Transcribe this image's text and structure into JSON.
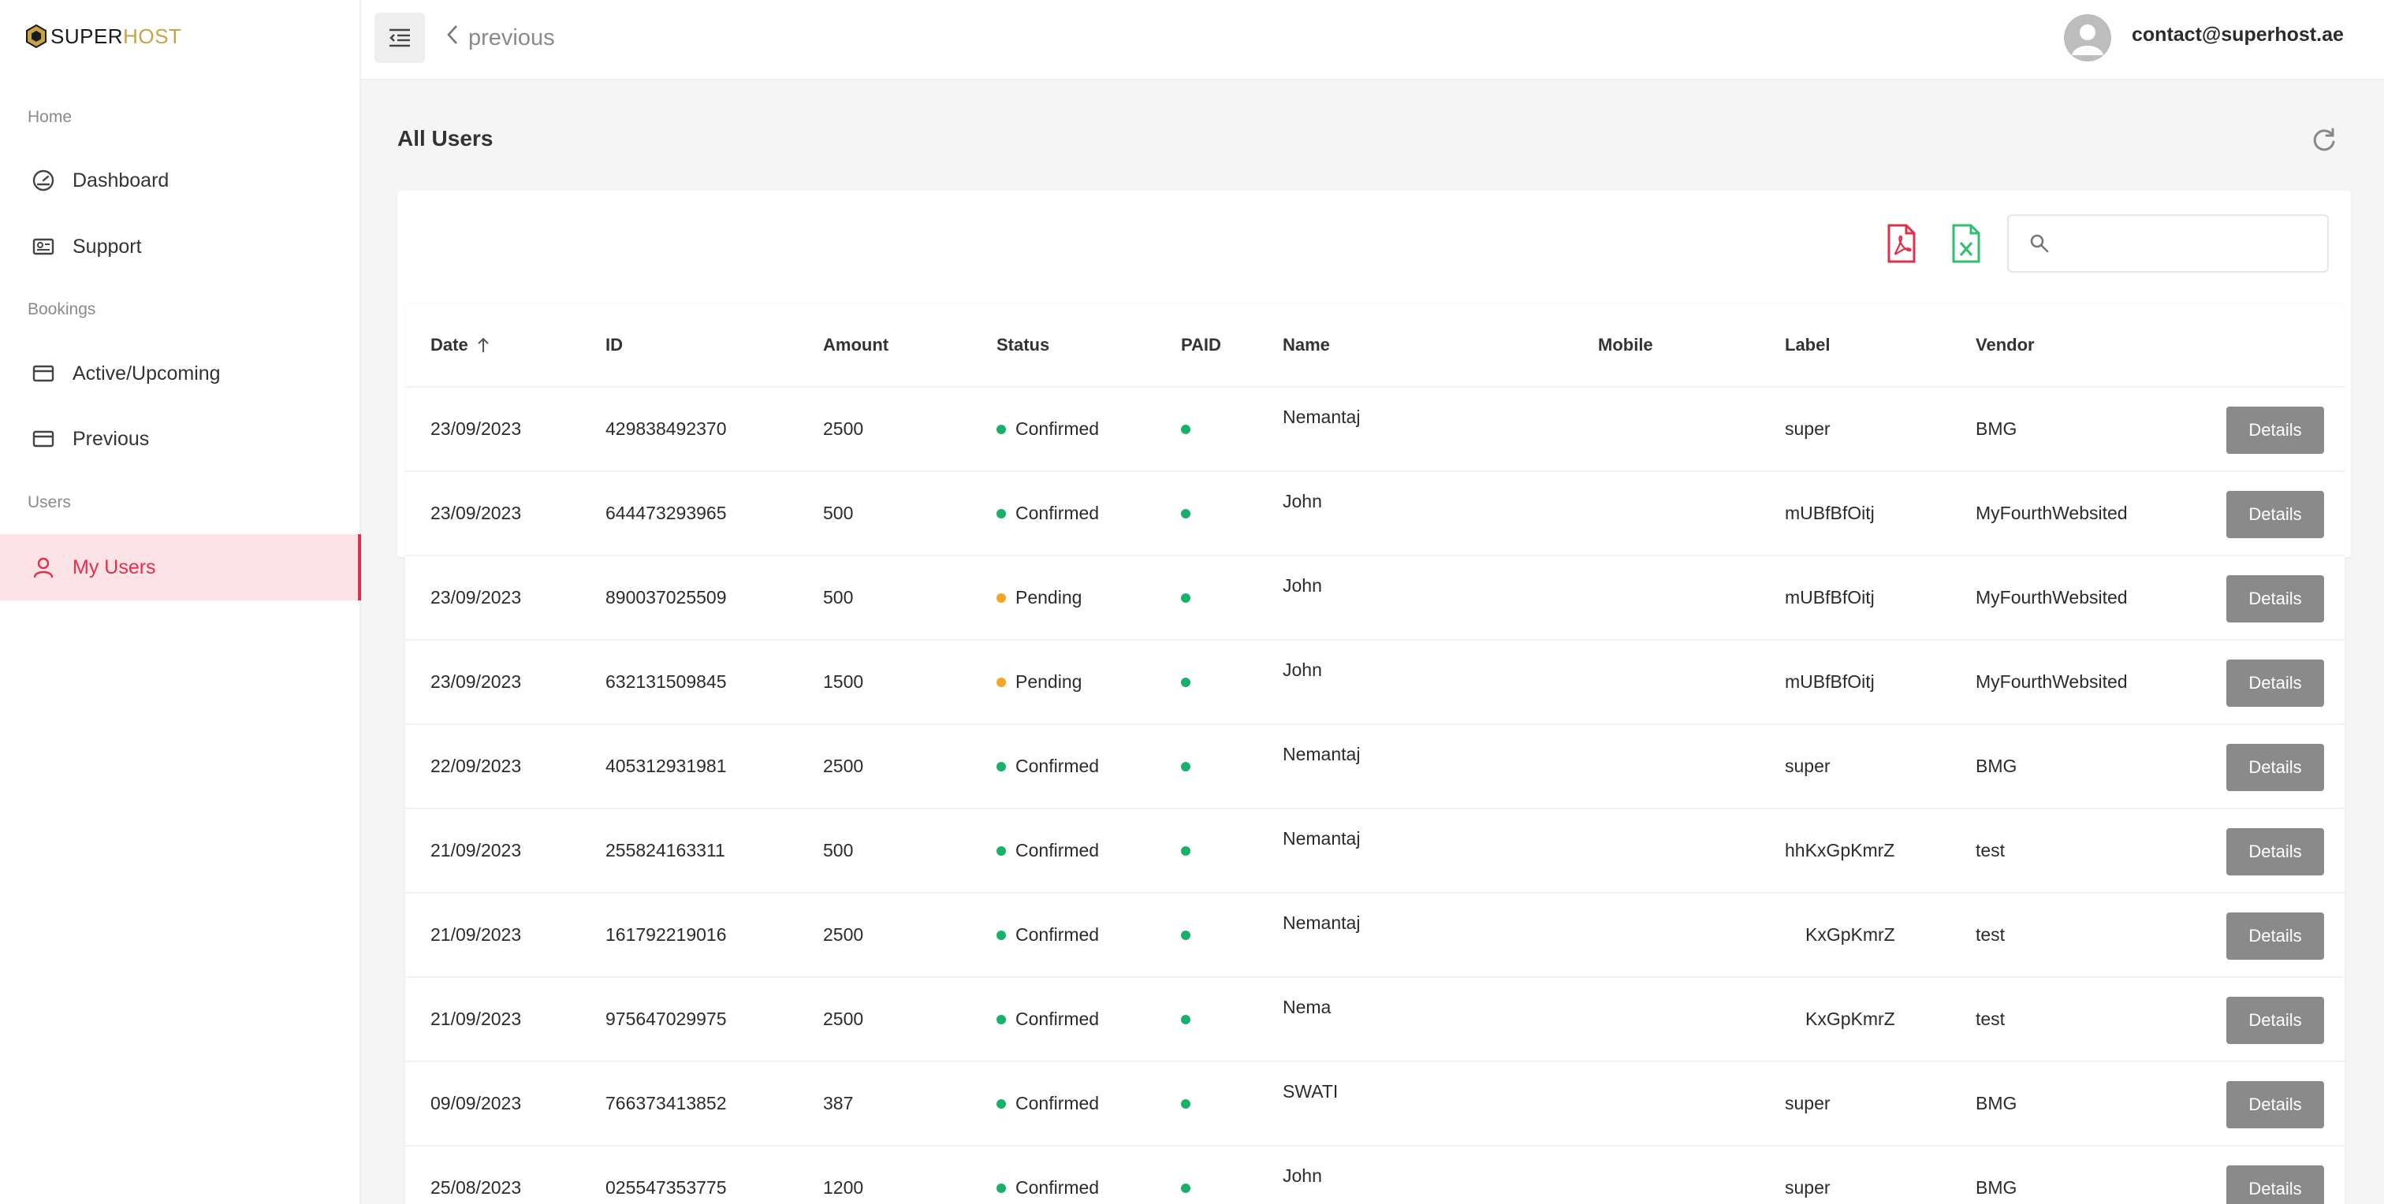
{
  "brand": {
    "super": "SUPER",
    "host": "HOST"
  },
  "sidebar": {
    "sections": [
      {
        "title": "Home"
      },
      {
        "title": "Bookings"
      },
      {
        "title": "Users"
      }
    ],
    "items": [
      {
        "label": "Dashboard",
        "icon": "dashboard-icon"
      },
      {
        "label": "Support",
        "icon": "support-card-icon"
      },
      {
        "label": "Active/Upcoming",
        "icon": "card-icon"
      },
      {
        "label": "Previous",
        "icon": "card-icon"
      },
      {
        "label": "My Users",
        "icon": "user-icon",
        "active": true
      }
    ]
  },
  "topbar": {
    "back_label": "previous",
    "user_email": "contact@superhost.ae"
  },
  "page": {
    "title": "All Users"
  },
  "search": {
    "placeholder": ""
  },
  "colors": {
    "accent": "#e0314c",
    "gold": "#c8a344",
    "confirmed": "#17b26a",
    "pending": "#f5a524",
    "pdf": "#e0314c",
    "excel": "#2fbf71"
  },
  "table": {
    "columns": [
      "Date",
      "ID",
      "Amount",
      "Status",
      "PAID",
      "Name",
      "Mobile",
      "Label",
      "Vendor"
    ],
    "action_label": "Details",
    "rows": [
      {
        "date": "23/09/2023",
        "id": "429838492370",
        "amount": "2500",
        "status": "Confirmed",
        "name": "Nemantaj",
        "mobile": "",
        "label": "super",
        "vendor": "BMG"
      },
      {
        "date": "23/09/2023",
        "id": "644473293965",
        "amount": "500",
        "status": "Confirmed",
        "name": "John",
        "mobile": "",
        "label": "mUBfBfOitj",
        "vendor": "MyFourthWebsited"
      },
      {
        "date": "23/09/2023",
        "id": "890037025509",
        "amount": "500",
        "status": "Pending",
        "name": "John",
        "mobile": "",
        "label": "mUBfBfOitj",
        "vendor": "MyFourthWebsited"
      },
      {
        "date": "23/09/2023",
        "id": "632131509845",
        "amount": "1500",
        "status": "Pending",
        "name": "John",
        "mobile": "",
        "label": "mUBfBfOitj",
        "vendor": "MyFourthWebsited"
      },
      {
        "date": "22/09/2023",
        "id": "405312931981",
        "amount": "2500",
        "status": "Confirmed",
        "name": "Nemantaj",
        "mobile": "",
        "label": "super",
        "vendor": "BMG"
      },
      {
        "date": "21/09/2023",
        "id": "255824163311",
        "amount": "500",
        "status": "Confirmed",
        "name": "Nemantaj",
        "mobile": "",
        "label": "hhKxGpKmrZ",
        "vendor": "test"
      },
      {
        "date": "21/09/2023",
        "id": "161792219016",
        "amount": "2500",
        "status": "Confirmed",
        "name": "Nemantaj",
        "mobile": "",
        "label": "KxGpKmrZ",
        "vendor": "test"
      },
      {
        "date": "21/09/2023",
        "id": "975647029975",
        "amount": "2500",
        "status": "Confirmed",
        "name": "Nema",
        "mobile": "",
        "label": "KxGpKmrZ",
        "vendor": "test"
      },
      {
        "date": "09/09/2023",
        "id": "766373413852",
        "amount": "387",
        "status": "Confirmed",
        "name": "SWATI",
        "mobile": "",
        "label": "super",
        "vendor": "BMG"
      },
      {
        "date": "25/08/2023",
        "id": "025547353775",
        "amount": "1200",
        "status": "Confirmed",
        "name": "John",
        "mobile": "",
        "label": "super",
        "vendor": "BMG"
      }
    ]
  }
}
